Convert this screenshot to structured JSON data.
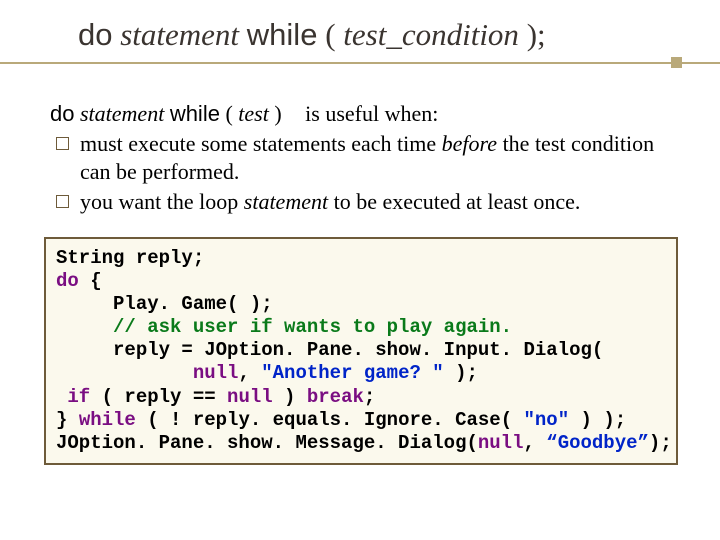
{
  "title": {
    "do": "do",
    "statement": "statement",
    "while": "while",
    "open": "(",
    "tc": "test_condition",
    "close": ");"
  },
  "intro": {
    "do": "do",
    "statement": "statement",
    "while": "while",
    "open": "(",
    "test": "test",
    "close": ")",
    "useful": "is useful when:"
  },
  "bullets": {
    "b1a": "must execute some statements each time ",
    "b1b": "before",
    "b1c": " the test condition can be performed.",
    "b2a": "you want the loop ",
    "b2b": "statement",
    "b2c": " to be executed at least once."
  },
  "code": {
    "l1a": "String reply;",
    "l2a": "do",
    "l2b": " {",
    "l3a": "     Play. Game( );",
    "l4a": "     // ask user if wants to play again.",
    "l5a": "     reply = JOption. Pane. show. Input. Dialog(",
    "l6a": "            ",
    "l6b": "null",
    "l6c": ", ",
    "l6d": "\"Another game? \"",
    "l6e": " );",
    "l7a": " ",
    "l7b": "if",
    "l7c": " ( reply == ",
    "l7d": "null",
    "l7e": " ) ",
    "l7f": "break",
    "l7g": ";",
    "l8a": "} ",
    "l8b": "while",
    "l8c": " ( ! reply. equals. Ignore. Case( ",
    "l8d": "\"no\"",
    "l8e": " ) );",
    "l9a": "JOption. Pane. show. Message. Dialog(",
    "l9b": "null",
    "l9c": ", ",
    "l9d": "“Goodbye”",
    "l9e": ");"
  }
}
